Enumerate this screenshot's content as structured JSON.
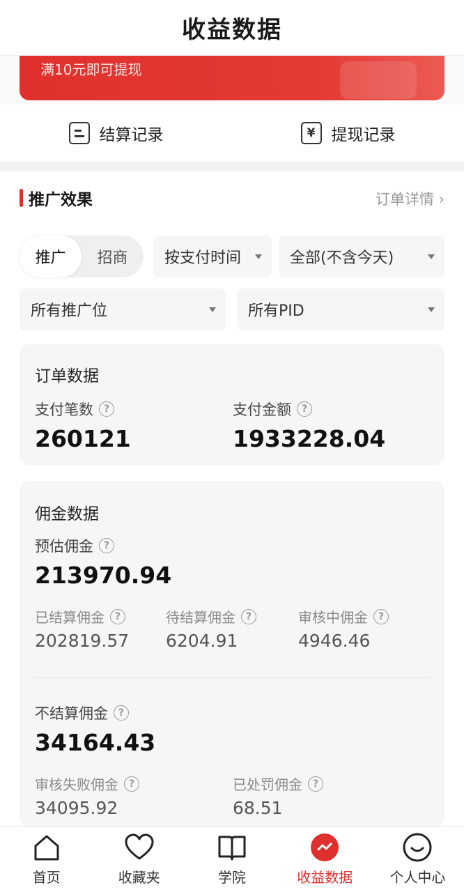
{
  "header": {
    "title": "收益数据"
  },
  "banner": {
    "text": "满10元即可提现",
    "color": "#e0302d"
  },
  "records": {
    "settlement_label": "结算记录",
    "withdraw_label": "提现记录",
    "withdraw_icon_glyph": "¥"
  },
  "promo": {
    "title": "推广效果",
    "detail_link": "订单详情 ›",
    "segment": {
      "items": [
        "推广",
        "招商"
      ],
      "selected": "推广"
    },
    "filters": {
      "time_basis": "按支付时间",
      "range": "全部(不含今天)",
      "position": "所有推广位",
      "pid": "所有PID"
    }
  },
  "order_data": {
    "title": "订单数据",
    "pay_count_label": "支付笔数",
    "pay_count": "260121",
    "pay_amount_label": "支付金额",
    "pay_amount": "1933228.04"
  },
  "commission": {
    "title": "佣金数据",
    "estimated_label": "预估佣金",
    "estimated": "213970.94",
    "settled_label": "已结算佣金",
    "settled": "202819.57",
    "pending_label": "待结算佣金",
    "pending": "6204.91",
    "reviewing_label": "审核中佣金",
    "reviewing": "4946.46",
    "unsettled_label": "不结算佣金",
    "unsettled": "34164.43",
    "failed_label": "审核失败佣金",
    "failed": "34095.92",
    "penalty_label": "已处罚佣金",
    "penalty": "68.51"
  },
  "help_glyph": "?",
  "tabbar": {
    "items": [
      {
        "label": "首页",
        "icon": "home-icon"
      },
      {
        "label": "收藏夹",
        "icon": "heart-icon"
      },
      {
        "label": "学院",
        "icon": "book-icon"
      },
      {
        "label": "收益数据",
        "icon": "earnings-icon"
      },
      {
        "label": "个人中心",
        "icon": "profile-icon"
      }
    ],
    "active": "收益数据",
    "active_color": "#e0302d"
  }
}
